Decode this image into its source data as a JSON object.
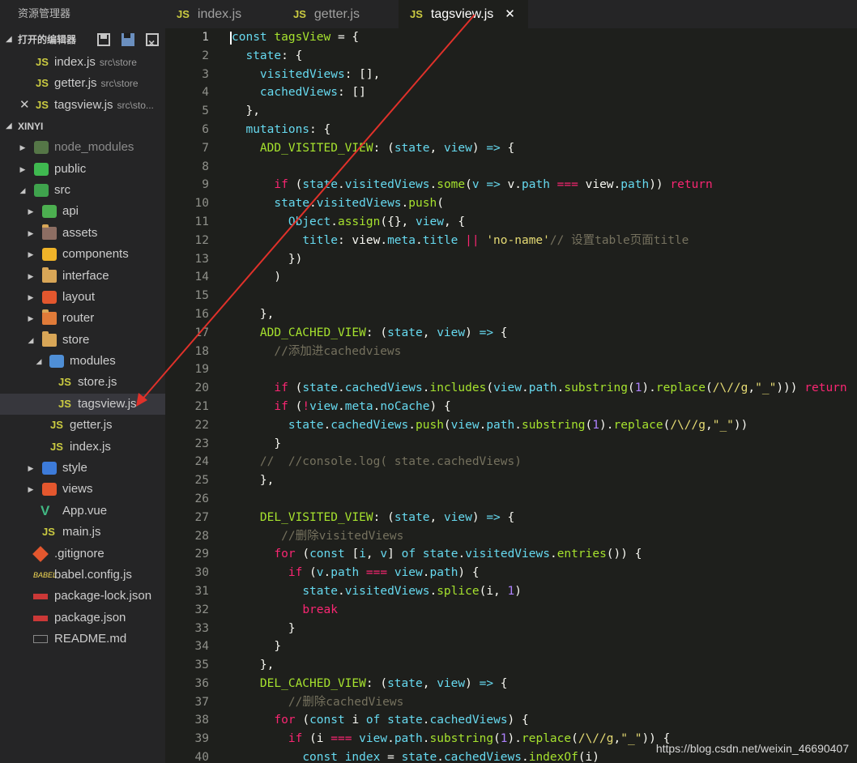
{
  "explorer": {
    "title": "资源管理器",
    "open_editors_label": "打开的编辑器",
    "open_editors": [
      {
        "badge": "JS",
        "name": "index.js",
        "path": "src\\store"
      },
      {
        "badge": "JS",
        "name": "getter.js",
        "path": "src\\store"
      },
      {
        "badge": "JS",
        "name": "tagsview.js",
        "path": "src\\sto..."
      }
    ],
    "project_label": "XINYI",
    "tree": {
      "node_modules": "node_modules",
      "public": "public",
      "src": "src",
      "api": "api",
      "assets": "assets",
      "components": "components",
      "interface": "interface",
      "layout": "layout",
      "router": "router",
      "store": "store",
      "modules": "modules",
      "store_js": "store.js",
      "tagsview_js": "tagsview.js",
      "getter_js": "getter.js",
      "index_js": "index.js",
      "style": "style",
      "views": "views",
      "app_vue": "App.vue",
      "main_js": "main.js",
      "gitignore": ".gitignore",
      "babel_config": "babel.config.js",
      "package_lock": "package-lock.json",
      "package_json": "package.json",
      "readme": "README.md",
      "js_badge": "JS",
      "vue_badge": "V"
    }
  },
  "tabs": [
    {
      "badge": "JS",
      "label": "index.js"
    },
    {
      "badge": "JS",
      "label": "getter.js"
    },
    {
      "badge": "JS",
      "label": "tagsview.js",
      "close": "✕"
    }
  ],
  "line_numbers": [
    "1",
    "2",
    "3",
    "4",
    "5",
    "6",
    "7",
    "8",
    "9",
    "10",
    "11",
    "12",
    "13",
    "14",
    "15",
    "16",
    "17",
    "18",
    "19",
    "20",
    "21",
    "22",
    "23",
    "24",
    "25",
    "26",
    "27",
    "28",
    "29",
    "30",
    "31",
    "32",
    "33",
    "34",
    "35",
    "36",
    "37",
    "38",
    "39",
    "40"
  ],
  "code": {
    "l1": [
      "const",
      " ",
      "tagsView",
      " = {"
    ],
    "l2": [
      "state",
      ": {"
    ],
    "l3": [
      "visitedViews",
      ": [],"
    ],
    "l4": [
      "cachedViews",
      ": []"
    ],
    "l5": "},",
    "l6": [
      "mutations",
      ": {"
    ],
    "l7": [
      "ADD_VISITED_VIEW",
      ": (",
      "state",
      ", ",
      "view",
      ") ",
      "=>",
      " {"
    ],
    "l9": [
      "if",
      " (",
      "state",
      ".",
      "visitedViews",
      ".",
      "some",
      "(",
      "v",
      " ",
      "=>",
      " v.",
      "path",
      " ",
      "===",
      " view.",
      "path",
      ")) ",
      "return"
    ],
    "l10": [
      "state",
      ".",
      "visitedViews",
      ".",
      "push",
      "("
    ],
    "l11": [
      "Object",
      ".",
      "assign",
      "({}, ",
      "view",
      ", {"
    ],
    "l12": [
      "title",
      ": view.",
      "meta",
      ".",
      "title",
      " ",
      "||",
      " ",
      "'no-name'",
      "// 设置table页面title"
    ],
    "l13": "})",
    "l14": ")",
    "l16": "},",
    "l17": [
      "ADD_CACHED_VIEW",
      ": (",
      "state",
      ", ",
      "view",
      ") ",
      "=>",
      " {"
    ],
    "l18": "//添加进cachedviews",
    "l20": [
      "if",
      " (",
      "state",
      ".",
      "cachedViews",
      ".",
      "includes",
      "(",
      "view",
      ".",
      "path",
      ".",
      "substring",
      "(",
      "1",
      ").",
      "replace",
      "(",
      "/\\//g",
      ",",
      "\"_\"",
      "))) ",
      "return"
    ],
    "l21": [
      "if",
      " (",
      "!",
      "view",
      ".",
      "meta",
      ".",
      "noCache",
      ") {"
    ],
    "l22": [
      "state",
      ".",
      "cachedViews",
      ".",
      "push",
      "(",
      "view",
      ".",
      "path",
      ".",
      "substring",
      "(",
      "1",
      ").",
      "replace",
      "(",
      "/\\//g",
      ",",
      "\"_\"",
      "))"
    ],
    "l23": "}",
    "l24": "//  //console.log( state.cachedViews)",
    "l25": "},",
    "l27": [
      "DEL_VISITED_VIEW",
      ": (",
      "state",
      ", ",
      "view",
      ") ",
      "=>",
      " {"
    ],
    "l28": "//删除visitedViews",
    "l29": [
      "for",
      " (",
      "const",
      " [",
      "i",
      ", ",
      "v",
      "] ",
      "of",
      " ",
      "state",
      ".",
      "visitedViews",
      ".",
      "entries",
      "()) {"
    ],
    "l30": [
      "if",
      " (",
      "v",
      ".",
      "path",
      " ",
      "===",
      " ",
      "view",
      ".",
      "path",
      ") {"
    ],
    "l31": [
      "state",
      ".",
      "visitedViews",
      ".",
      "splice",
      "(i, ",
      "1",
      ")"
    ],
    "l32": "break",
    "l33": "}",
    "l34": "}",
    "l35": "},",
    "l36": [
      "DEL_CACHED_VIEW",
      ": (",
      "state",
      ", ",
      "view",
      ") ",
      "=>",
      " {"
    ],
    "l37": "//删除cachedViews",
    "l38": [
      "for",
      " (",
      "const",
      " i ",
      "of",
      " ",
      "state",
      ".",
      "cachedViews",
      ") {"
    ],
    "l39": [
      "if",
      " (i ",
      "===",
      " ",
      "view",
      ".",
      "path",
      ".",
      "substring",
      "(",
      "1",
      ").",
      "replace",
      "(",
      "/\\//g",
      ",",
      "\"_\"",
      ")) {"
    ],
    "l40": [
      "const",
      " ",
      "index",
      " = ",
      "state",
      ".",
      "cachedViews",
      ".",
      "indexOf",
      "(i)"
    ]
  },
  "watermark": "https://blog.csdn.net/weixin_46690407",
  "colors": {
    "accent": "#e0312a",
    "js_badge": "#cbcb41",
    "folder": "#d8a657"
  }
}
